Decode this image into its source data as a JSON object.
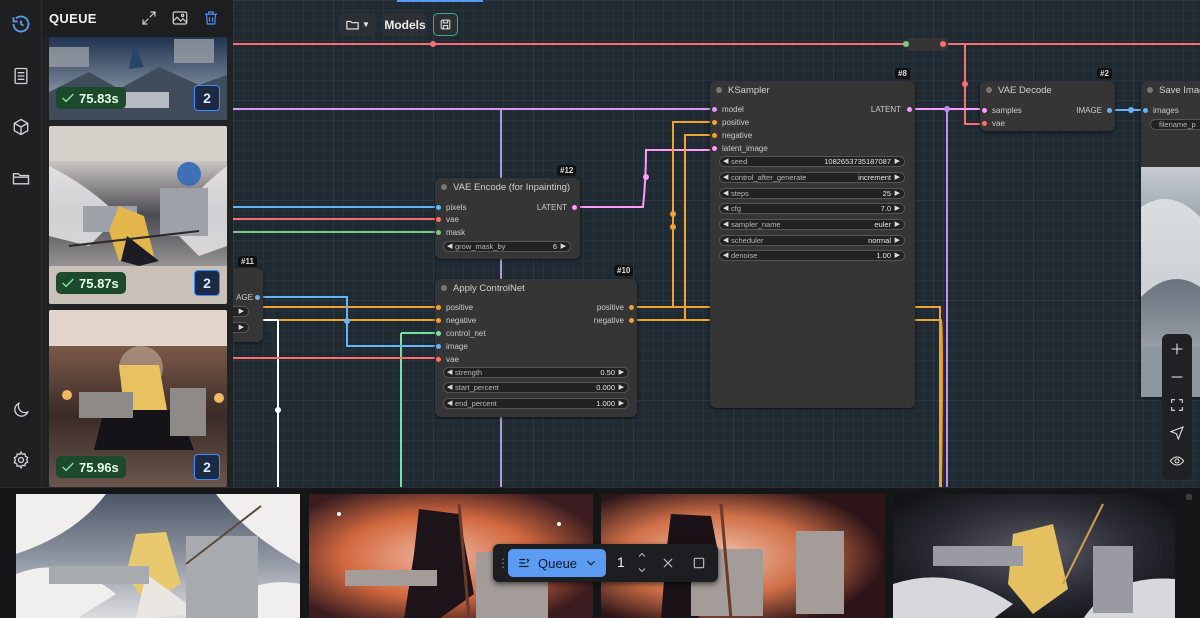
{
  "colors": {
    "accent": "#5b9cf2",
    "model": "#d79cf0",
    "conditioning": "#f0a330",
    "latent": "#ff9cf9",
    "vae": "#ff6e6e",
    "image": "#64b5f6",
    "mask": "#81c784",
    "control_net": "#77e0a0"
  },
  "queue_panel": {
    "title": "QUEUE",
    "items": [
      {
        "time": "75.83s",
        "count": "2"
      },
      {
        "time": "75.87s",
        "count": "2"
      },
      {
        "time": "75.96s",
        "count": "2"
      }
    ]
  },
  "toolbar": {
    "models_label": "Models"
  },
  "nodes": {
    "ksampler": {
      "id": "#8",
      "title": "KSampler",
      "inputs": [
        "model",
        "positive",
        "negative",
        "latent_image"
      ],
      "output": "LATENT",
      "widgets": [
        {
          "label": "seed",
          "value": "1082653735187087"
        },
        {
          "label": "control_after_generate",
          "value": "increment"
        },
        {
          "label": "steps",
          "value": "25"
        },
        {
          "label": "cfg",
          "value": "7.0"
        },
        {
          "label": "sampler_name",
          "value": "euler"
        },
        {
          "label": "scheduler",
          "value": "normal"
        },
        {
          "label": "denoise",
          "value": "1.00"
        }
      ]
    },
    "vae_decode": {
      "id": "#2",
      "title": "VAE Decode",
      "inputs": [
        "samples",
        "vae"
      ],
      "output": "IMAGE"
    },
    "save_image": {
      "title": "Save Imag",
      "inputs": [
        "images"
      ],
      "widget_placeholder": "filename_p"
    },
    "vae_encode": {
      "id": "#12",
      "title": "VAE Encode (for Inpainting)",
      "inputs": [
        "pixels",
        "vae",
        "mask"
      ],
      "output": "LATENT",
      "widgets": [
        {
          "label": "grow_mask_by",
          "value": "6"
        }
      ]
    },
    "apply_controlnet": {
      "id": "#10",
      "title": "Apply ControlNet",
      "inputs": [
        "positive",
        "negative",
        "control_net",
        "image",
        "vae"
      ],
      "outputs": [
        "positive",
        "negative"
      ],
      "widgets": [
        {
          "label": "strength",
          "value": "0.50"
        },
        {
          "label": "start_percent",
          "value": "0.000"
        },
        {
          "label": "end_percent",
          "value": "1.000"
        }
      ]
    },
    "node11": {
      "id": "#11",
      "output_fragment": "AGE"
    }
  },
  "queue_bar": {
    "button_label": "Queue",
    "batch_count": "1"
  }
}
